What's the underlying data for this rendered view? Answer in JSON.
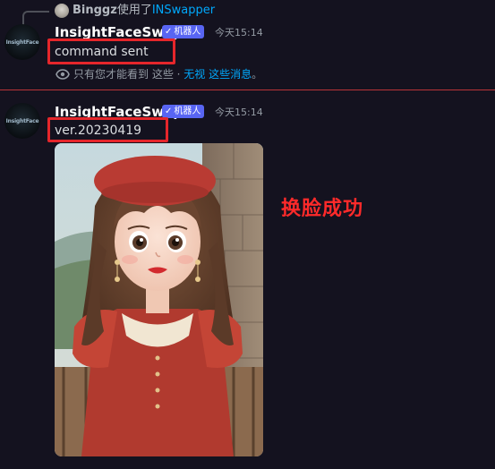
{
  "reply": {
    "username": "Binggz",
    "action": "使用了",
    "command": "INSwapper"
  },
  "messages": [
    {
      "avatar_text": "InsightFace",
      "username": "InsightFaceSwap",
      "bot_tag": "机器人",
      "timestamp": "今天15:14",
      "content": "command sent",
      "ephemeral": {
        "prefix": "只有您才能看到 这些 · ",
        "dismiss": "无视",
        "suffix_link": "这些消息",
        "end": "。"
      }
    },
    {
      "avatar_text": "InsightFace",
      "username": "InsightFaceSwap",
      "bot_tag": "机器人",
      "timestamp": "今天15:14",
      "content": "ver.20230419"
    }
  ],
  "annotation": "换脸成功",
  "colors": {
    "background": "#14121f",
    "bot_tag": "#5865f2",
    "link": "#00a8fc",
    "highlight_box": "#e5262b",
    "annotation": "#ff2a2a"
  },
  "icons": {
    "verified": "check-icon",
    "ephemeral": "eye-icon"
  }
}
